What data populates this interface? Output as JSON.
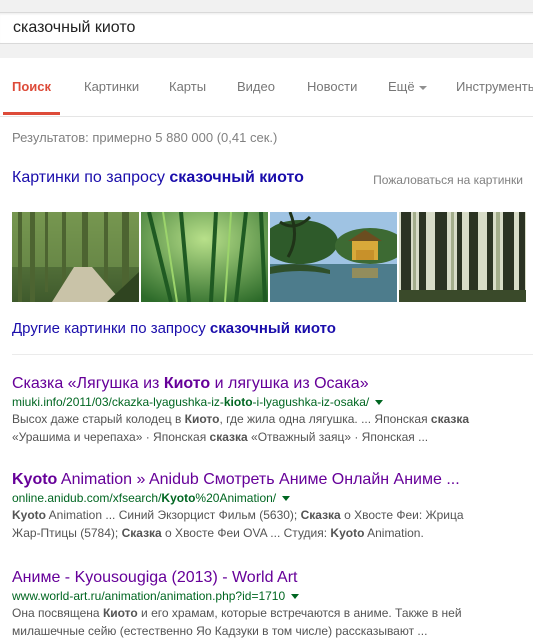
{
  "search": {
    "query": "сказочный киото"
  },
  "tabs": {
    "search": "Поиск",
    "images": "Картинки",
    "maps": "Карты",
    "video": "Видео",
    "news": "Новости",
    "more": "Ещё",
    "tools": "Инструменты"
  },
  "stats": "Результатов: примерно 5 880 000 (0,41 сек.)",
  "images_block": {
    "heading_prefix": "Картинки по запросу ",
    "heading_query": "сказочный киото",
    "report": "Пожаловаться на картинки",
    "more_prefix": "Другие картинки по запросу ",
    "more_query": "сказочный киото",
    "thumbs": [
      "bamboo-path",
      "bamboo-forest",
      "kinkakuji-pavilion",
      "bamboo-grove"
    ]
  },
  "results": [
    {
      "title_parts": [
        "Сказка «Лягушка из ",
        "Киото",
        " и лягушка из Осака»"
      ],
      "url_parts": [
        "miuki.info/2011/03/ckazka-lyagushka-iz-",
        "kioto",
        "-i-lyagushka-iz-osaka/"
      ],
      "snippet_line1": [
        "Высох даже старый колодец в ",
        "Киото",
        ", где жила одна лягушка. ... Японская ",
        "сказка"
      ],
      "snippet_line2": [
        "«Урашима и черепаха» · Японская ",
        "сказка",
        " «Отважный заяц» · Японская ..."
      ]
    },
    {
      "title_parts": [
        "Kyoto",
        " Animation » Anidub Смотреть Аниме Онлайн Аниме ..."
      ],
      "url_parts": [
        "online.anidub.com/xfsearch/",
        "Kyoto",
        "%20Animation/"
      ],
      "snippet_line1": [
        "Kyoto",
        " Animation ... Синий Экзорцист Фильм (5630); ",
        "Сказка",
        " о Хвосте Феи: Жрица"
      ],
      "snippet_line2": [
        "Жар-Птицы (5784); ",
        "Сказка",
        " о Хвосте Феи OVA ... Студия: ",
        "Kyoto",
        " Animation."
      ]
    },
    {
      "title_parts": [
        "Аниме - Kyousougiga (2013) - World Art"
      ],
      "url_parts": [
        "www.world-art.ru/animation/animation.php?id=1710"
      ],
      "snippet_line1": [
        "Она посвящена ",
        "Киото",
        " и его храмам, которые встречаются в аниме. Также в ней"
      ],
      "snippet_line2": [
        "милашечные сейю (естественно Яо Кадзуки в том числе) рассказывают ..."
      ]
    }
  ]
}
